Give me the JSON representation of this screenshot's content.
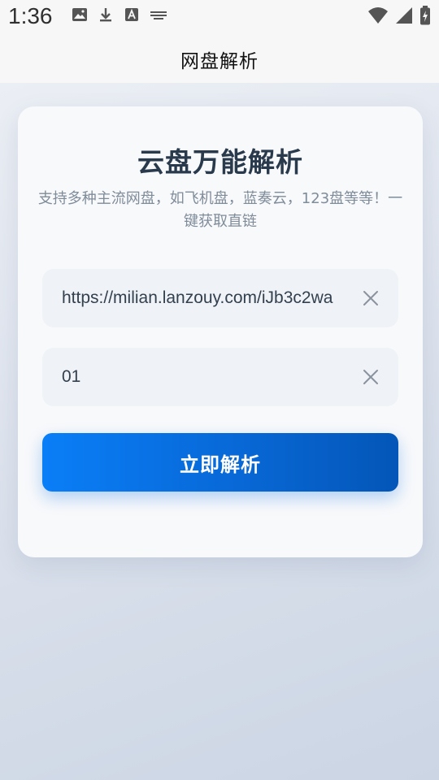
{
  "status_bar": {
    "time": "1:36",
    "left_icons": [
      "image-icon",
      "download-icon",
      "font-icon",
      "keyboard-icon"
    ],
    "right_icons": [
      "wifi-icon",
      "signal-icon",
      "battery-charging-icon"
    ]
  },
  "app_bar": {
    "title": "网盘解析"
  },
  "card": {
    "title": "云盘万能解析",
    "subtitle": "支持多种主流网盘，如飞机盘，蓝奏云，123盘等等！一键获取直链",
    "url_field": {
      "value": "https://milian.lanzouy.com/iJb3c2wa"
    },
    "code_field": {
      "value": "01"
    },
    "parse_button_label": "立即解析"
  },
  "colors": {
    "primary": "#0a7ef7",
    "title": "#2a3a4d",
    "subtitle": "#7f8c99",
    "field_bg": "#eff2f6"
  }
}
